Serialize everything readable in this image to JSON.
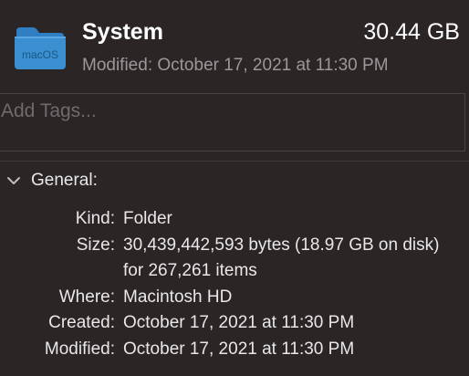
{
  "header": {
    "folder_icon_label": "macOS",
    "title": "System",
    "size": "30.44 GB",
    "modified_line": "Modified: October 17, 2021 at 11:30 PM"
  },
  "tags": {
    "placeholder": "Add Tags...",
    "value": ""
  },
  "general": {
    "section_title": "General:",
    "expanded": true,
    "rows": [
      {
        "label": "Kind:",
        "value": "Folder"
      },
      {
        "label": "Size:",
        "value": "30,439,442,593 bytes (18.97 GB on disk) for 267,261 items"
      },
      {
        "label": "Where:",
        "value": "Macintosh HD"
      },
      {
        "label": "Created:",
        "value": "October 17, 2021 at 11:30 PM"
      },
      {
        "label": "Modified:",
        "value": "October 17, 2021 at 11:30 PM"
      }
    ]
  },
  "colors": {
    "background": "#2b2526",
    "folder_blue": "#3a8fd0",
    "secondary_text": "#9c9899"
  }
}
